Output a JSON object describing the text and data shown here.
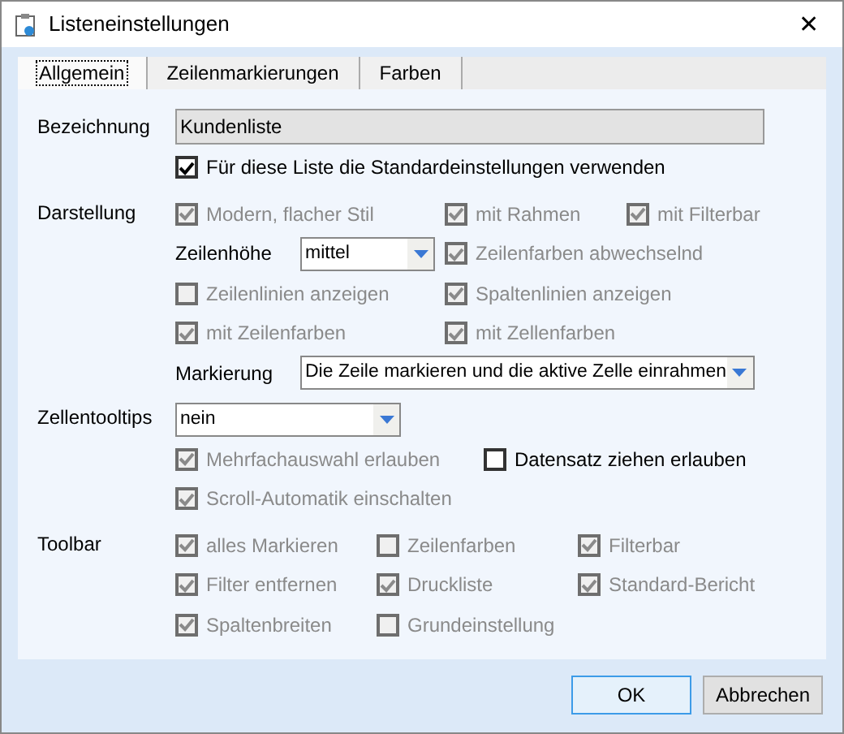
{
  "window": {
    "title": "Listeneinstellungen",
    "close": "✕"
  },
  "tabs": [
    {
      "label": "Allgemein",
      "selected": true
    },
    {
      "label": "Zeilenmarkierungen",
      "selected": false
    },
    {
      "label": "Farben",
      "selected": false
    }
  ],
  "sections": [
    {
      "label": "Bezeichnung",
      "rows": [
        [
          {
            "kind": "textbox",
            "value": "Kundenliste"
          }
        ],
        [
          {
            "kind": "checkbox",
            "text": "Für diese Liste die Standardeinstellungen verwenden",
            "checked": true,
            "disabled": false
          }
        ]
      ]
    },
    {
      "label": "Darstellung",
      "rows": [
        [
          {
            "kind": "checkbox",
            "text": "Modern, flacher Stil",
            "checked": true,
            "disabled": true
          },
          {
            "kind": "checkbox",
            "text": "mit Rahmen",
            "checked": true,
            "disabled": true
          },
          {
            "kind": "checkbox",
            "text": "mit Filterbar",
            "checked": true,
            "disabled": true
          }
        ],
        [
          {
            "kind": "select",
            "label": "Zeilenhöhe",
            "value": "mittel"
          },
          {
            "kind": "checkbox",
            "text": "Zeilenfarben abwechselnd",
            "checked": true,
            "disabled": true
          }
        ],
        [
          {
            "kind": "checkbox",
            "text": "Zeilenlinien anzeigen",
            "checked": false,
            "disabled": true
          },
          {
            "kind": "checkbox",
            "text": "Spaltenlinien anzeigen",
            "checked": true,
            "disabled": true
          }
        ],
        [
          {
            "kind": "checkbox",
            "text": "mit Zeilenfarben",
            "checked": true,
            "disabled": true
          },
          {
            "kind": "checkbox",
            "text": "mit Zellenfarben",
            "checked": true,
            "disabled": true
          }
        ],
        [
          {
            "kind": "select",
            "label": "Markierung",
            "value": "Die Zeile markieren und die aktive Zelle einrahmen"
          }
        ]
      ]
    },
    {
      "label": "Zellentooltips",
      "rows": [
        [
          {
            "kind": "select",
            "value": "nein"
          }
        ],
        [
          {
            "kind": "checkbox",
            "text": "Mehrfachauswahl erlauben",
            "checked": true,
            "disabled": true
          },
          {
            "kind": "checkbox",
            "text": "Datensatz ziehen erlauben",
            "checked": false,
            "disabled": false
          }
        ],
        [
          {
            "kind": "checkbox",
            "text": "Scroll-Automatik einschalten",
            "checked": true,
            "disabled": true
          }
        ]
      ]
    },
    {
      "label": "Toolbar",
      "rows": [
        [
          {
            "kind": "checkbox",
            "text": "alles Markieren",
            "checked": true,
            "disabled": true
          },
          {
            "kind": "checkbox",
            "text": "Zeilenfarben",
            "checked": false,
            "disabled": true
          },
          {
            "kind": "checkbox",
            "text": "Filterbar",
            "checked": true,
            "disabled": true
          }
        ],
        [
          {
            "kind": "checkbox",
            "text": "Filter entfernen",
            "checked": true,
            "disabled": true
          },
          {
            "kind": "checkbox",
            "text": "Druckliste",
            "checked": true,
            "disabled": true
          },
          {
            "kind": "checkbox",
            "text": "Standard-Bericht",
            "checked": true,
            "disabled": true
          }
        ],
        [
          {
            "kind": "checkbox",
            "text": "Spaltenbreiten",
            "checked": true,
            "disabled": true
          },
          {
            "kind": "checkbox",
            "text": "Grundeinstellung",
            "checked": false,
            "disabled": true
          }
        ]
      ]
    }
  ],
  "buttons": [
    {
      "label": "OK",
      "default": true
    },
    {
      "label": "Abbrechen",
      "default": false
    }
  ]
}
